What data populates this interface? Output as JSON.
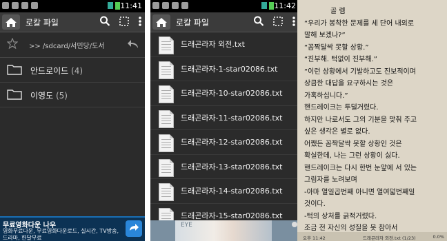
{
  "panel1": {
    "status_time": "11:41",
    "title": "로칼 파일",
    "path": ">> /sdcard/서민당/도서",
    "folders": [
      {
        "name": "안드로이드",
        "count": "(4)"
      },
      {
        "name": "이영도",
        "count": "(5)"
      }
    ],
    "ad": {
      "title": "무료영화다운 나우",
      "subtitle": "영화무료다운, 무료영화다운로드, 실시간, TV방송, 드라마, 한달무료"
    }
  },
  "panel2": {
    "status_time": "11:42",
    "title": "로칼 파일",
    "files": [
      "드래곤라자 외전.txt",
      "드래곤라자-1-star02086.txt",
      "드래곤라자-10-star02086.txt",
      "드래곤라자-11-star02086.txt",
      "드래곤라자-12-star02086.txt",
      "드래곤라자-13-star02086.txt",
      "드래곤라자-14-star02086.txt",
      "드래곤라자-15-star02086.txt"
    ],
    "ad_text": "EYE"
  },
  "panel3": {
    "lines": [
      "골 렘",
      "“우리가 봉착한 문제를 세 단어 내외로",
      "말해 보겠나?”",
      "“꼼짝달싹 못할 상황.”",
      "“진부해. 턱없이 진부해.”",
      "“이런 상황에서 기발하고도 진보적이며",
      "상큼한 대답을 요구하시는 것은",
      "가혹하십니다.”",
      "핸드레이크는 투덜거렸다.",
      " 하지만 나로서도 그의 기분을 맞춰 주고",
      "싶은 생각은 별로 없다.",
      " 어쨌든 꼼짝달싹 못할 상황인 것은",
      "확실한데, 나는 그런 상황이 싫다.",
      " 핸드레이크는 다시 한번 눈앞에 서 있는",
      "그림자를 노려보며",
      " -아마 열일곱번째 아니면 열여덟번째일",
      "것이다.",
      "-턱의 상처를 긁적거렸다.",
      " 조금 전 자신의 성질을 못 참아서"
    ],
    "footer": {
      "time": "오후 11:42",
      "file": "드래곤라자 외전.txt (1/23)",
      "percent": "0.0%"
    }
  }
}
